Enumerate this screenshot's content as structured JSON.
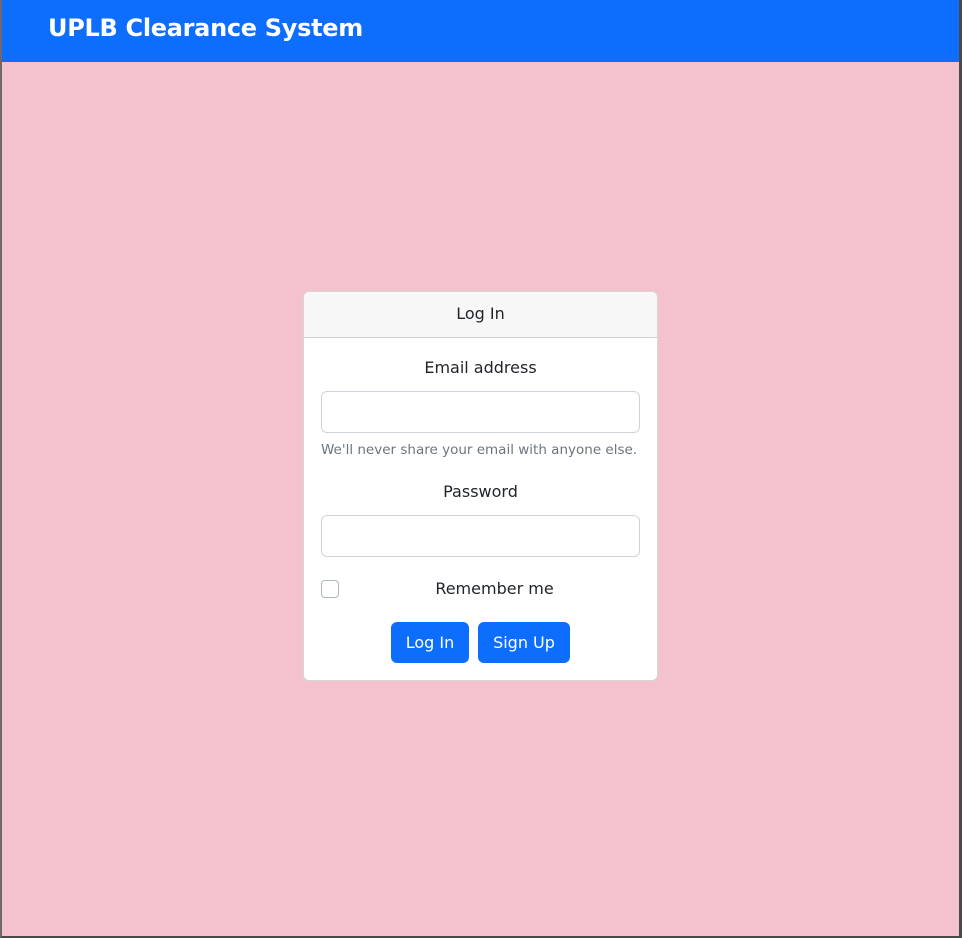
{
  "navbar": {
    "brand": "UPLB Clearance System"
  },
  "login_card": {
    "title": "Log In",
    "email_label": "Email address",
    "email_value": "",
    "email_help": "We'll never share your email with anyone else.",
    "password_label": "Password",
    "password_value": "",
    "remember_label": "Remember me",
    "remember_checked": false,
    "login_button": "Log In",
    "signup_button": "Sign Up"
  },
  "colors": {
    "primary": "#0d6efd",
    "background": "#f4c2cd"
  }
}
